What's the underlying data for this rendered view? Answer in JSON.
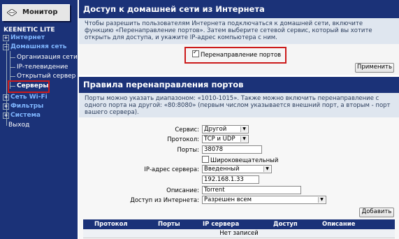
{
  "sidebar": {
    "monitor_label": "Монитор",
    "brand": "KEENETIC LITE",
    "items": [
      {
        "label": "Интернет",
        "type": "top"
      },
      {
        "label": "Домашняя сеть",
        "type": "top"
      },
      {
        "label": "Организация сети",
        "type": "sub"
      },
      {
        "label": "IP-телевидение",
        "type": "sub"
      },
      {
        "label": "Открытый сервер",
        "type": "sub"
      },
      {
        "label": "Серверы",
        "type": "sub",
        "selected": true
      },
      {
        "label": "Сеть Wi-Fi",
        "type": "top"
      },
      {
        "label": "Фильтры",
        "type": "top"
      },
      {
        "label": "Система",
        "type": "top"
      },
      {
        "label": "Выход",
        "type": "plain"
      }
    ]
  },
  "access_section": {
    "title": "Доступ к домашней сети из Интернета",
    "description": "Чтобы разрешить пользователям Интернета подключаться к домашней сети, включите функцию «Перенаправление портов». Затем выберите сетевой сервис, который вы хотите открыть для доступа, и укажите IP-адрес компьютера с ним.",
    "checkbox_label": "Перенаправление портов",
    "checkbox_checked": true,
    "apply_button": "Применить"
  },
  "rules_section": {
    "title": "Правила перенаправления портов",
    "description": "Порты можно указать диапазоном: «1010-1015». Также можно включить перенаправление с одного порта на другой: «80:8080» (первым числом указывается внешний порт, а вторым - порт вашего сервера).",
    "service_label": "Сервис:",
    "service_value": "Другой",
    "protocol_label": "Протокол:",
    "protocol_value": "TCP и UDP",
    "ports_label": "Порты:",
    "ports_value": "38078",
    "broadcast_label": "Широковещательный",
    "broadcast_checked": false,
    "server_ip_label": "IP-адрес сервера:",
    "server_ip_mode": "Введенный",
    "server_ip_value": "192.168.1.33",
    "description_label": "Описание:",
    "description_value": "Torrent",
    "internet_access_label": "Доступ из Интернета:",
    "internet_access_value": "Разрешен всем",
    "add_button": "Добавить"
  },
  "table": {
    "columns": [
      "Протокол",
      "Порты",
      "IP сервера",
      "Доступ",
      "Описание"
    ],
    "empty_text": "Нет записей"
  },
  "colors": {
    "accent": "#1b3278",
    "highlight": "#cc1b1b",
    "description_bg": "#dfe6ef"
  }
}
